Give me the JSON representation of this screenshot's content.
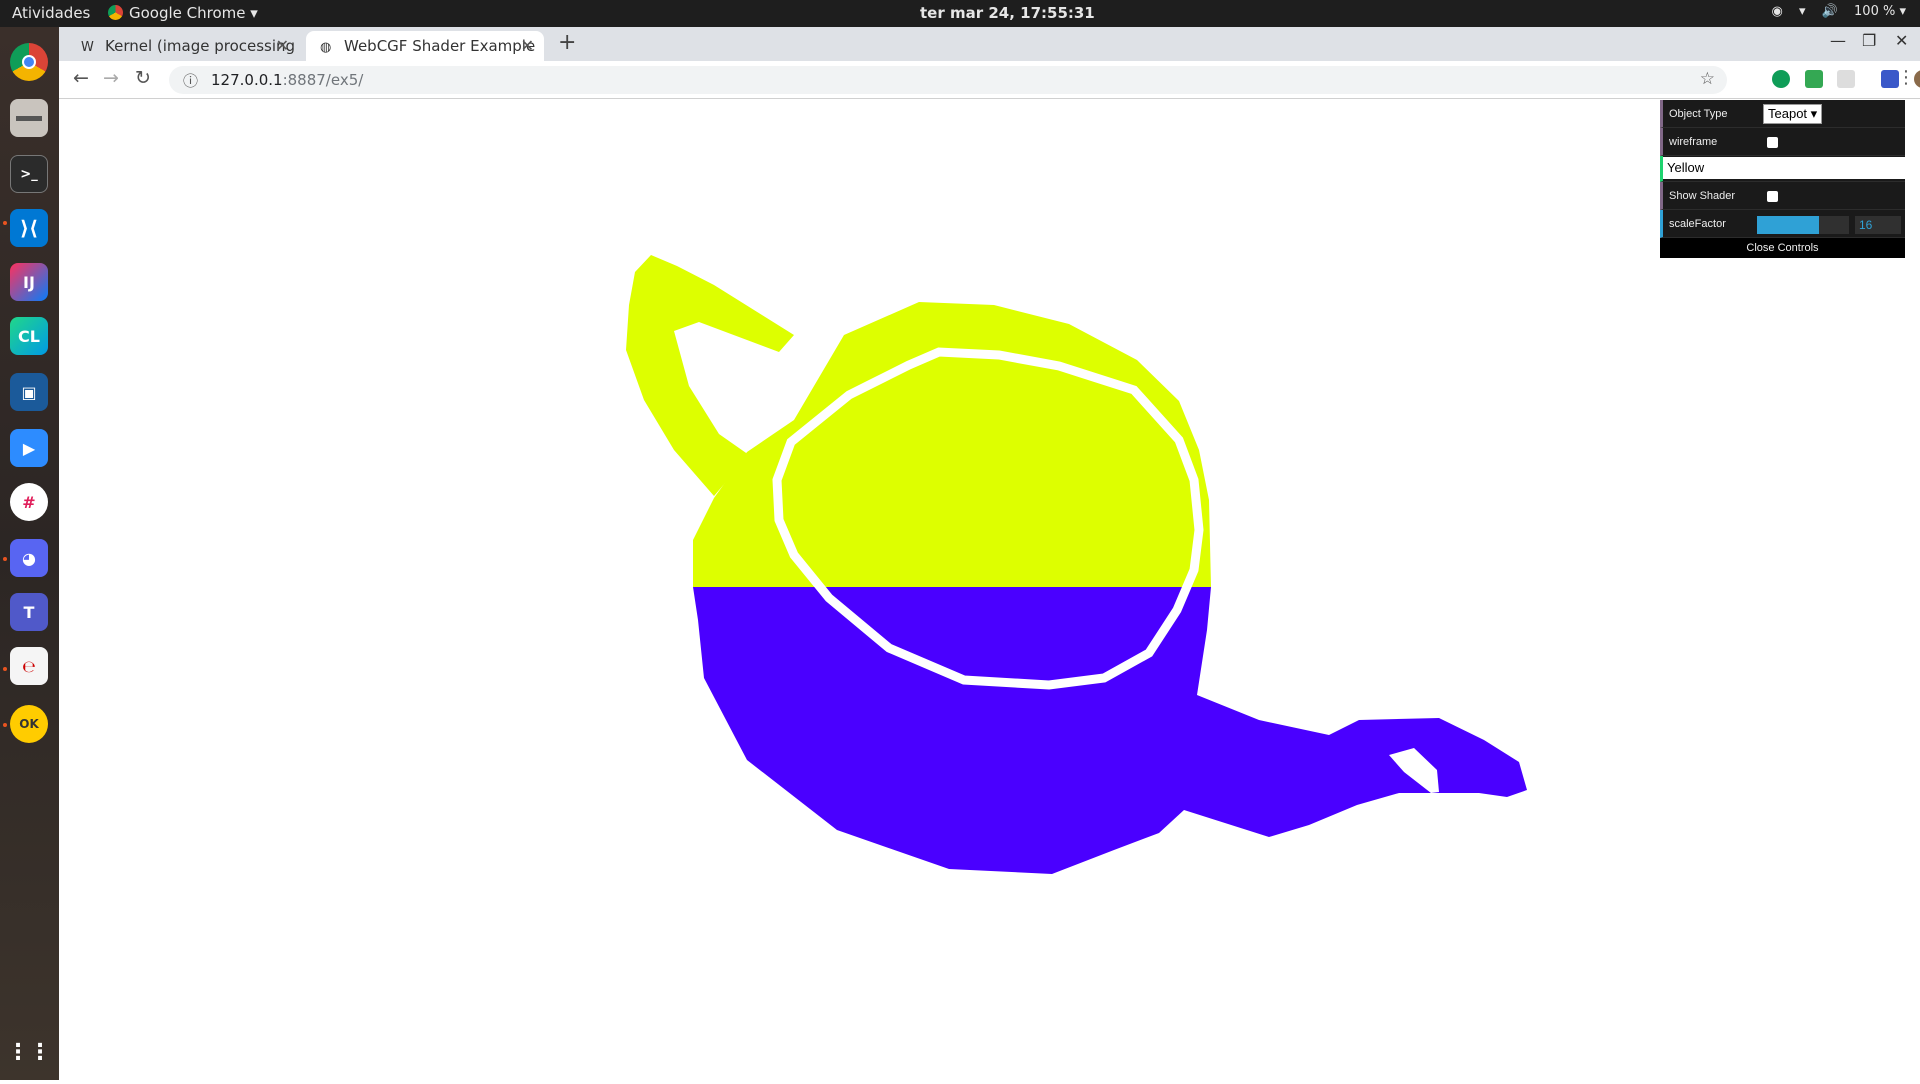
{
  "topbar": {
    "activities": "Atividades",
    "app_name": "Google Chrome ▾",
    "clock": "ter mar 24, 17:55:31",
    "battery": "100 % ▾"
  },
  "browser": {
    "tabs": [
      {
        "favicon": "W",
        "title": "Kernel (image processing",
        "active": false
      },
      {
        "favicon": "🌐",
        "title": "WebCGF Shader Example",
        "active": true
      }
    ],
    "url_host": "127.0.0.1",
    "url_path": ":8887/ex5/"
  },
  "gui": {
    "object_type_label": "Object Type",
    "object_type_value": "Teapot ▾",
    "wireframe_label": "wireframe",
    "color_value": "Yellow",
    "show_shader_label": "Show Shader",
    "scale_label": "scaleFactor",
    "scale_value": "16",
    "scale_fraction": 0.67,
    "close_label": "Close Controls"
  },
  "scene": {
    "top_color": "#ddff00",
    "bottom_color": "#4a00ff",
    "outline_color": "#ffffff"
  },
  "dock_icons": [
    "chrome-icon",
    "files-icon",
    "terminal-icon",
    "vscode-icon",
    "intellij-icon",
    "clion-icon",
    "virtualbox-icon",
    "zoom-icon",
    "slack-icon",
    "discord-icon",
    "teams-icon",
    "text-editor-icon",
    "okular-icon",
    "apps-grid-icon"
  ]
}
